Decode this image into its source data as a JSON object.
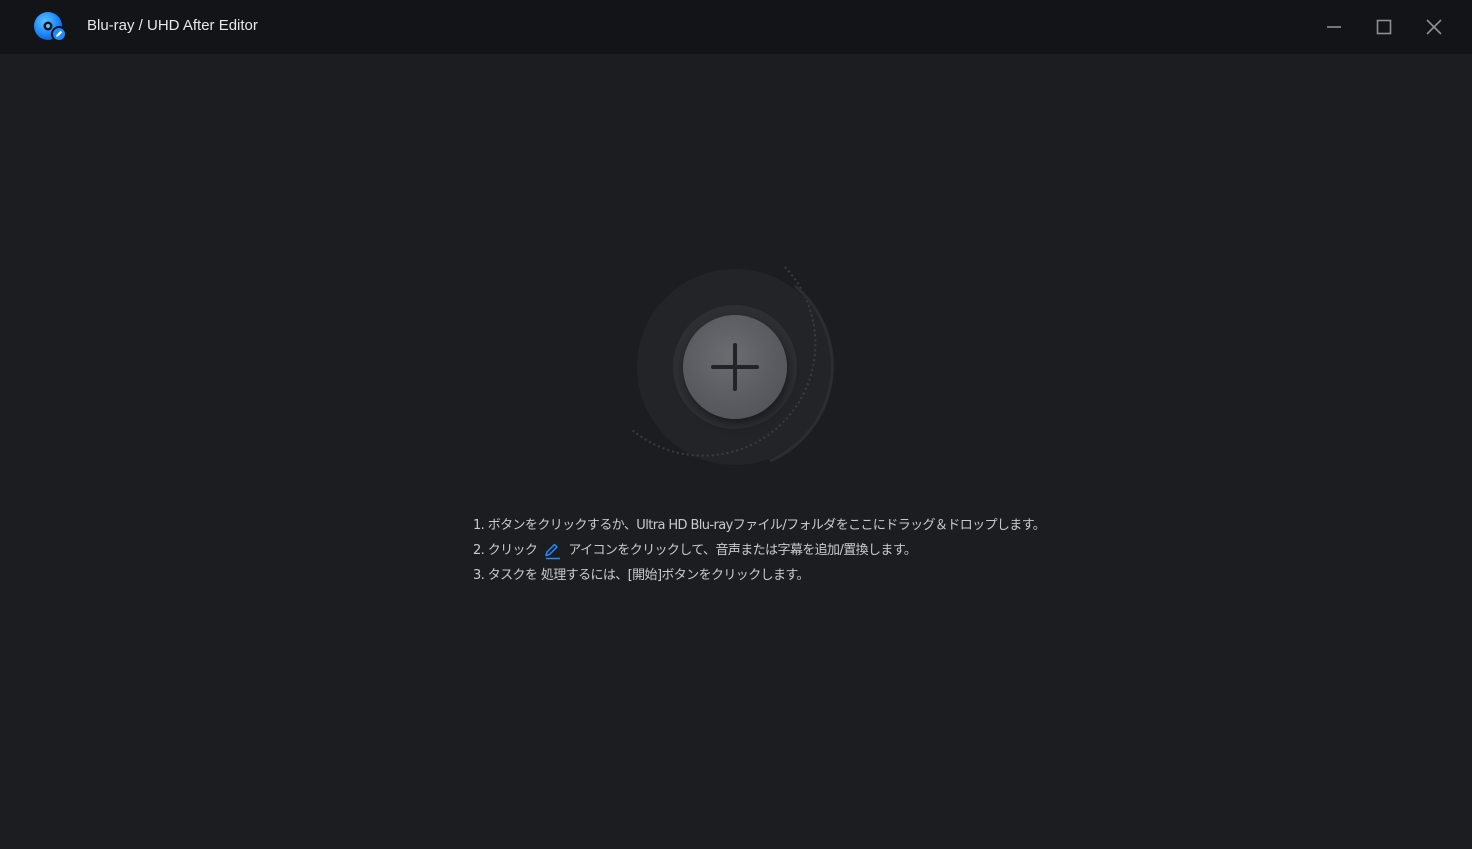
{
  "window": {
    "title": "Blu-ray / UHD After Editor",
    "logo_icon": "blu-ray-disc-edit-icon",
    "controls": [
      "minimize-icon",
      "maximize-icon",
      "close-icon"
    ]
  },
  "main": {
    "add_button_icon": "plus-icon",
    "instructions": {
      "line1": "1. ボタンをクリックするか、Ultra HD Blu-rayファイル/フォルダをここにドラッグ＆ドロップします。",
      "line2_before": "2. クリック",
      "line2_icon": "edit-pencil-icon",
      "line2_after": "アイコンをクリックして、音声または字幕を追加/置換します。",
      "line3": "3. タスクを 処理するには、[開始]ボタンをクリックします。"
    }
  },
  "colors": {
    "background": "#1c1d20",
    "titlebar": "#131417",
    "accent_blue": "#1e8cff",
    "text": "#c9cacd"
  }
}
